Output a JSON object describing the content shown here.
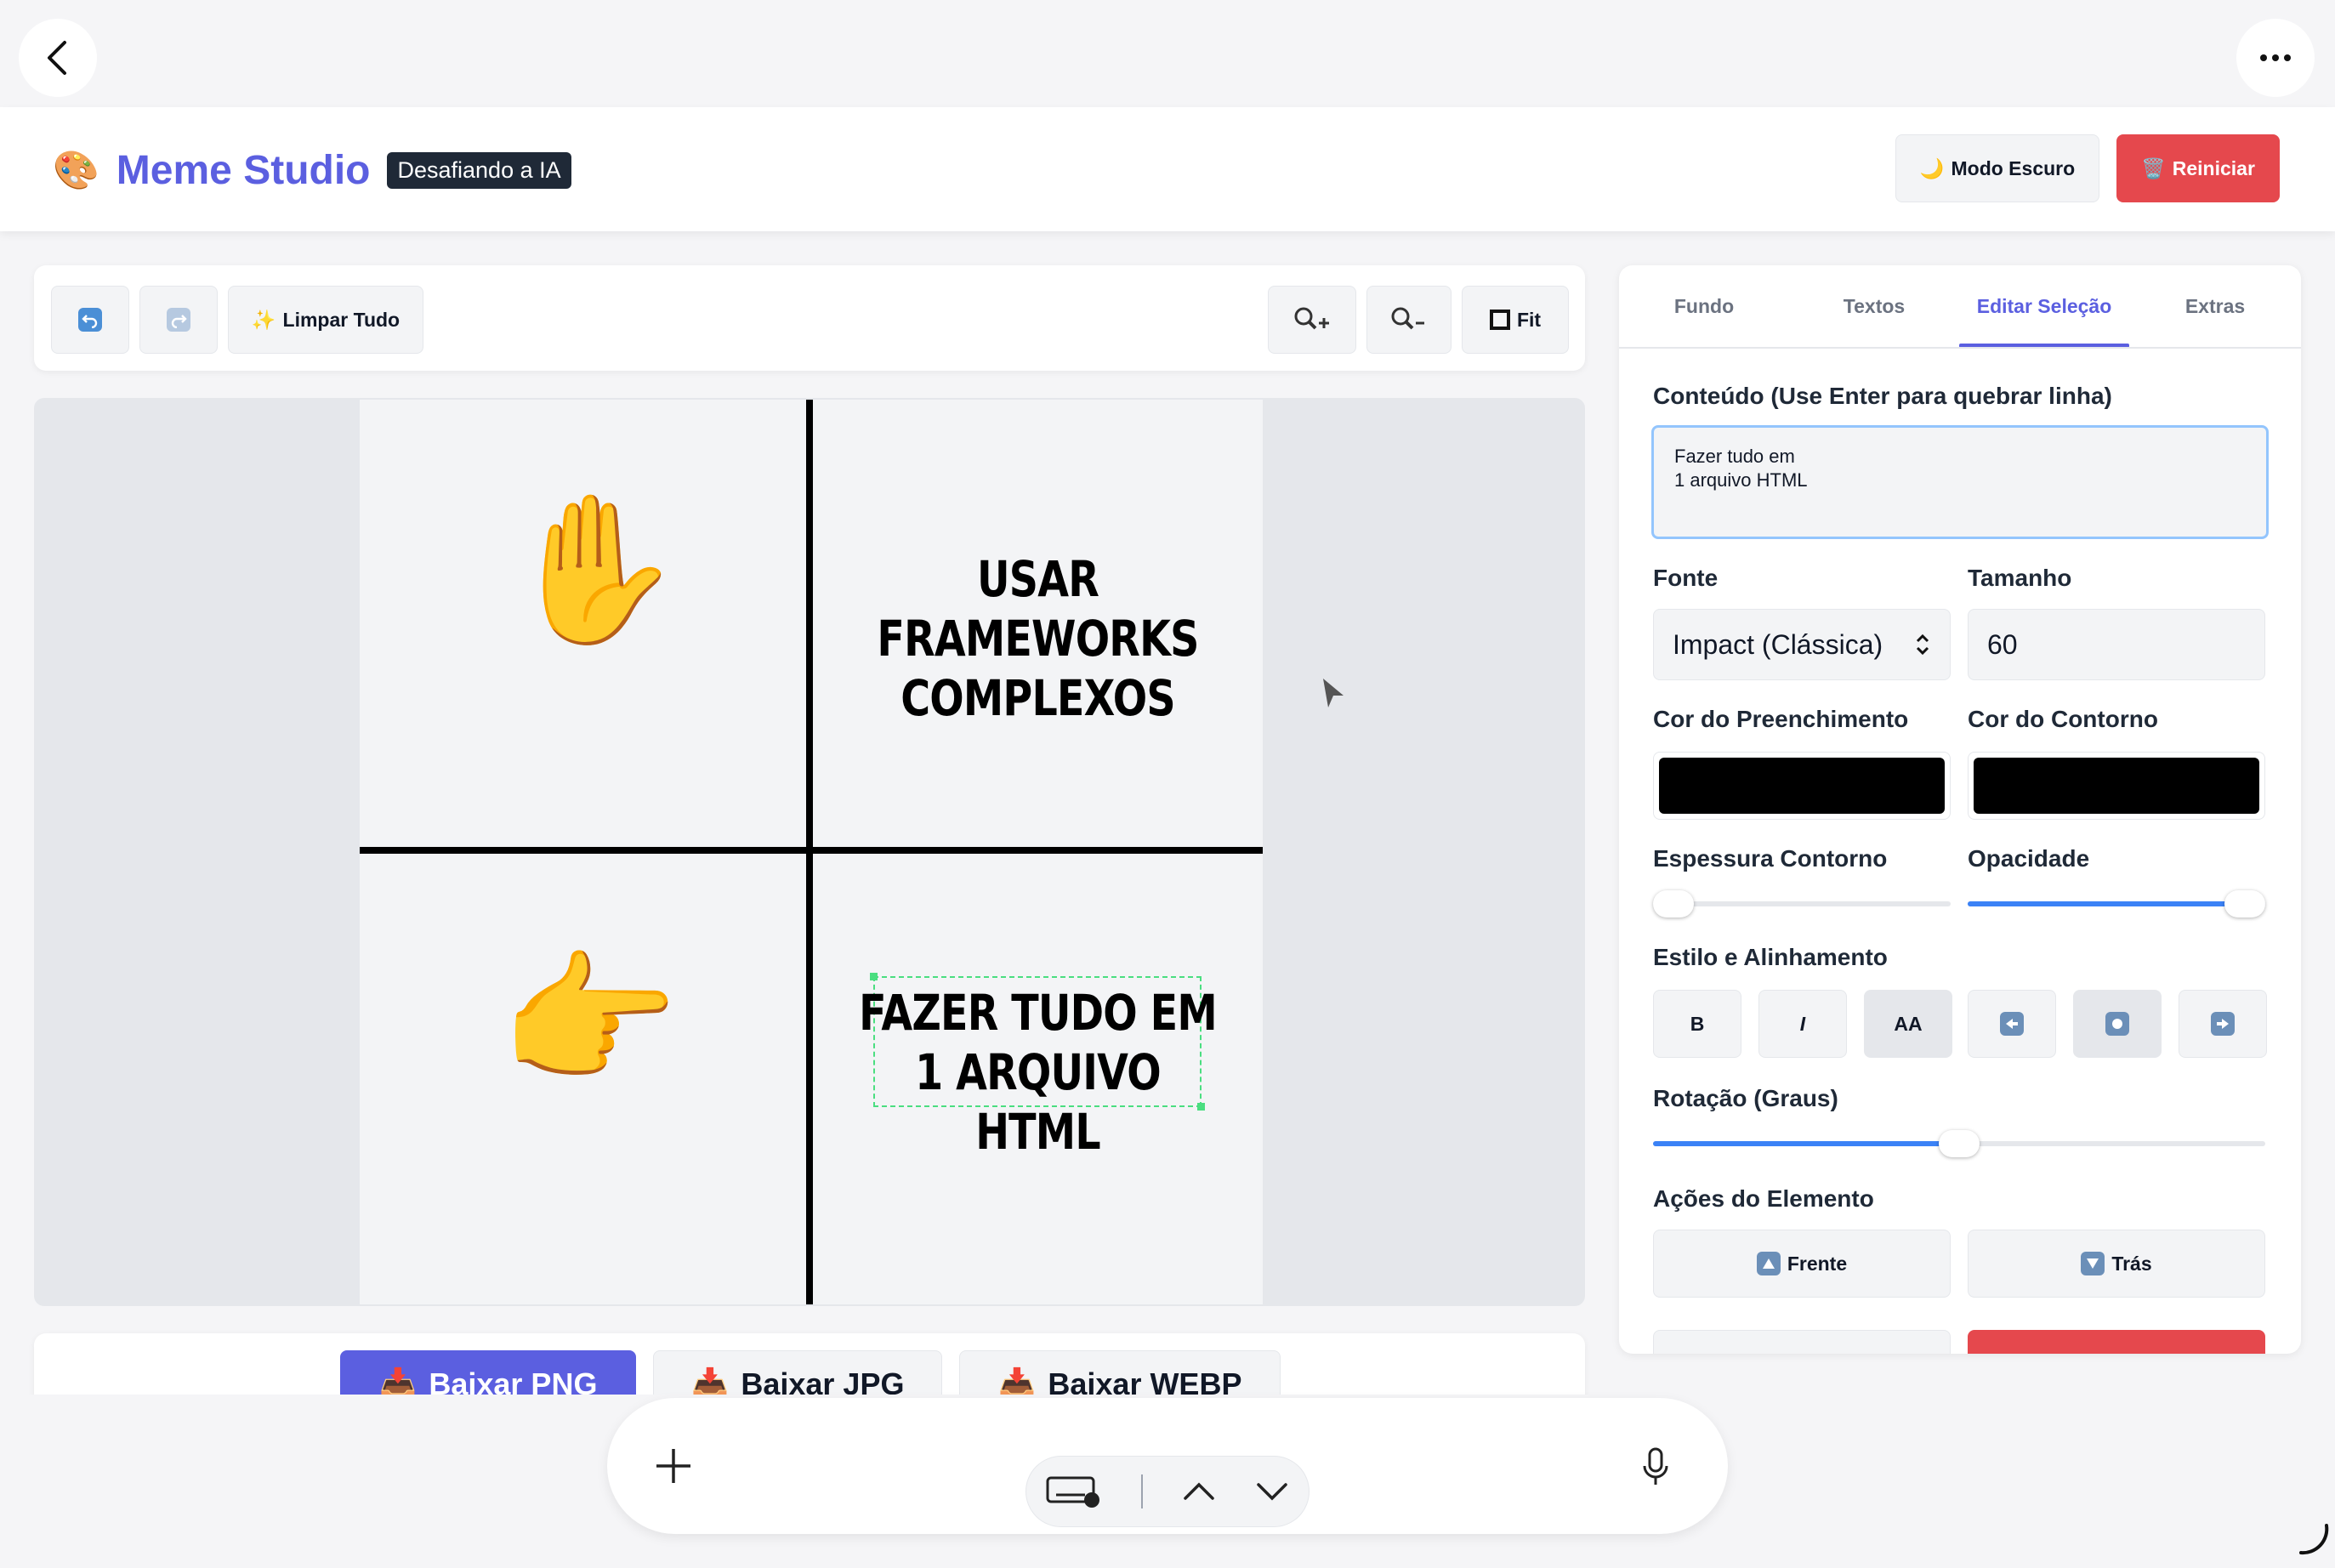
{
  "header": {
    "brand_emoji": "🎨",
    "title": "Meme Studio",
    "badge": "Desafiando a IA",
    "dark_mode_icon": "🌙",
    "dark_mode_label": "Modo Escuro",
    "reset_icon": "🗑️",
    "reset_label": "Reiniciar"
  },
  "toolbar": {
    "clear_icon": "✨",
    "clear_label": "Limpar Tudo",
    "fit_label": "Fit"
  },
  "meme": {
    "panel1_emoji": "✋",
    "panel2_text": "USAR FRAMEWORKS\nCOMPLEXOS",
    "panel3_emoji": "👉",
    "panel4_text": "FAZER TUDO EM\n1 ARQUIVO HTML"
  },
  "downloads": {
    "png": "Baixar PNG",
    "jpg": "Baixar JPG",
    "webp": "Baixar WEBP",
    "icon": "📥"
  },
  "panel": {
    "tabs": [
      {
        "label": "Fundo"
      },
      {
        "label": "Textos"
      },
      {
        "label": "Editar Seleção"
      },
      {
        "label": "Extras"
      }
    ],
    "content_label": "Conteúdo (Use Enter para quebrar linha)",
    "content_value": "Fazer tudo em\n1 arquivo HTML",
    "font_label": "Fonte",
    "font_value": "Impact (Clássica)",
    "size_label": "Tamanho",
    "size_value": "60",
    "fill_label": "Cor do Preenchimento",
    "stroke_label": "Cor do Contorno",
    "fill_color": "#000000",
    "stroke_color": "#000000",
    "stroke_width_label": "Espessura Contorno",
    "opacity_label": "Opacidade",
    "stroke_width_value": 0,
    "opacity_value": 1,
    "style_label": "Estilo e Alinhamento",
    "bold": "B",
    "italic": "I",
    "caps": "AA",
    "rotation_label": "Rotação (Graus)",
    "rotation_value": 0,
    "actions_label": "Ações do Elemento",
    "front_label": "Frente",
    "back_label": "Trás"
  },
  "colors": {
    "accent": "#5b5fe0",
    "danger": "#e5484d",
    "slider": "#3b82f6"
  }
}
